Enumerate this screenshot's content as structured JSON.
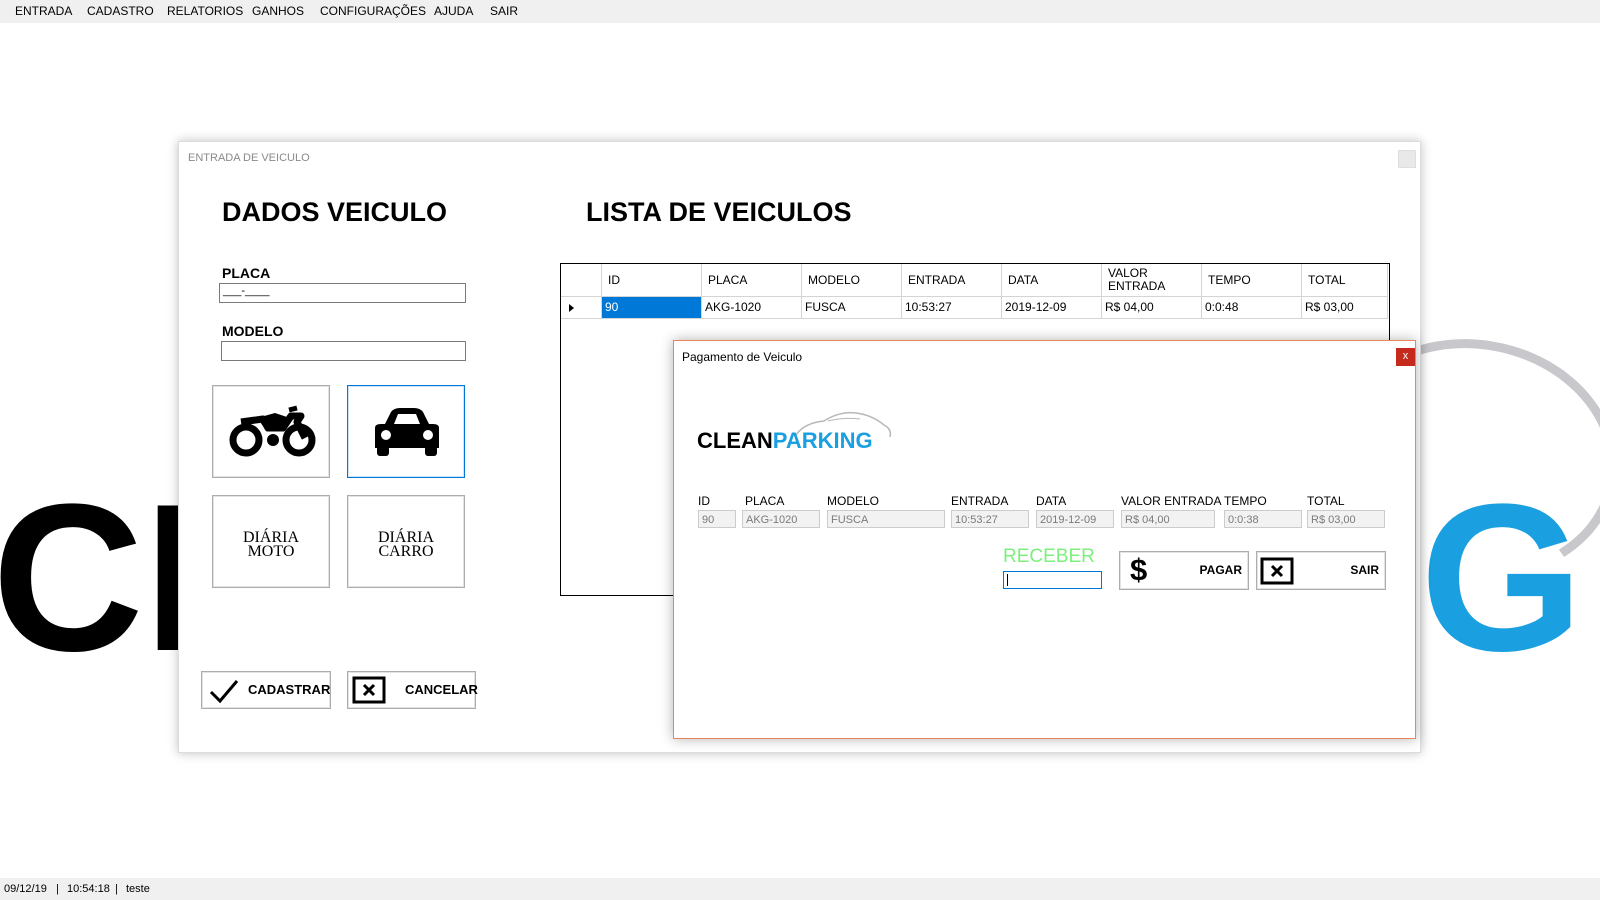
{
  "menu": {
    "items": [
      {
        "label": "ENTRADA"
      },
      {
        "label": "CADASTRO"
      },
      {
        "label": "RELATORIOS"
      },
      {
        "label": "GANHOS"
      },
      {
        "label": "CONFIGURAÇÕES"
      },
      {
        "label": "AJUDA"
      },
      {
        "label": "SAIR"
      }
    ]
  },
  "background_logo": {
    "left_text": "CL",
    "right_text": "G",
    "left_color": "#000000",
    "right_color": "#1aa0e0"
  },
  "entry_form": {
    "title": "ENTRADA DE VEICULO",
    "section_vehicle": "DADOS VEICULO",
    "section_list": "LISTA DE VEICULOS",
    "placa_label": "PLACA",
    "placa_value": "___-____",
    "modelo_label": "MODELO",
    "modelo_value": "",
    "moto_icon": "motorcycle-icon",
    "car_icon": "car-icon",
    "diaria_moto_line1": "DIÁRIA",
    "diaria_moto_line2": "MOTO",
    "diaria_carro_line1": "DIÁRIA",
    "diaria_carro_line2": "CARRO",
    "cadastrar_label": "CADASTRAR",
    "cancelar_label": "CANCELAR"
  },
  "vehicle_list": {
    "columns": {
      "id": "ID",
      "placa": "PLACA",
      "modelo": "MODELO",
      "entrada": "ENTRADA",
      "data": "DATA",
      "valor_entrada_line1": "VALOR",
      "valor_entrada_line2": "ENTRADA",
      "tempo": "TEMPO",
      "total": "TOTAL"
    },
    "rows": [
      {
        "id": "90",
        "placa": "AKG-1020",
        "modelo": "FUSCA",
        "entrada": "10:53:27",
        "data": "2019-12-09",
        "valor_entrada": "R$ 04,00",
        "tempo": "0:0:48",
        "total": "R$ 03,00"
      }
    ]
  },
  "payment_dialog": {
    "title": "Pagamento de Veiculo",
    "close_label": "x",
    "logo_clean": "CLEAN",
    "logo_parking": "PARKING",
    "fields": {
      "id_label": "ID",
      "id_value": "90",
      "placa_label": "PLACA",
      "placa_value": "AKG-1020",
      "modelo_label": "MODELO",
      "modelo_value": "FUSCA",
      "entrada_label": "ENTRADA",
      "entrada_value": "10:53:27",
      "data_label": "DATA",
      "data_value": "2019-12-09",
      "valor_entrada_label": "VALOR ENTRADA",
      "valor_entrada_value": "R$ 04,00",
      "tempo_label": "TEMPO",
      "tempo_value": "0:0:38",
      "total_label": "TOTAL",
      "total_value": "R$ 03,00"
    },
    "receber_label": "RECEBER",
    "receber_value": "",
    "pagar_label": "PAGAR",
    "sair_label": "SAIR",
    "colors": {
      "receber": "#7cf07c",
      "parking": "#1aa0e0"
    }
  },
  "status_bar": {
    "date": "09/12/19",
    "time": "10:54:18",
    "user": "teste"
  }
}
